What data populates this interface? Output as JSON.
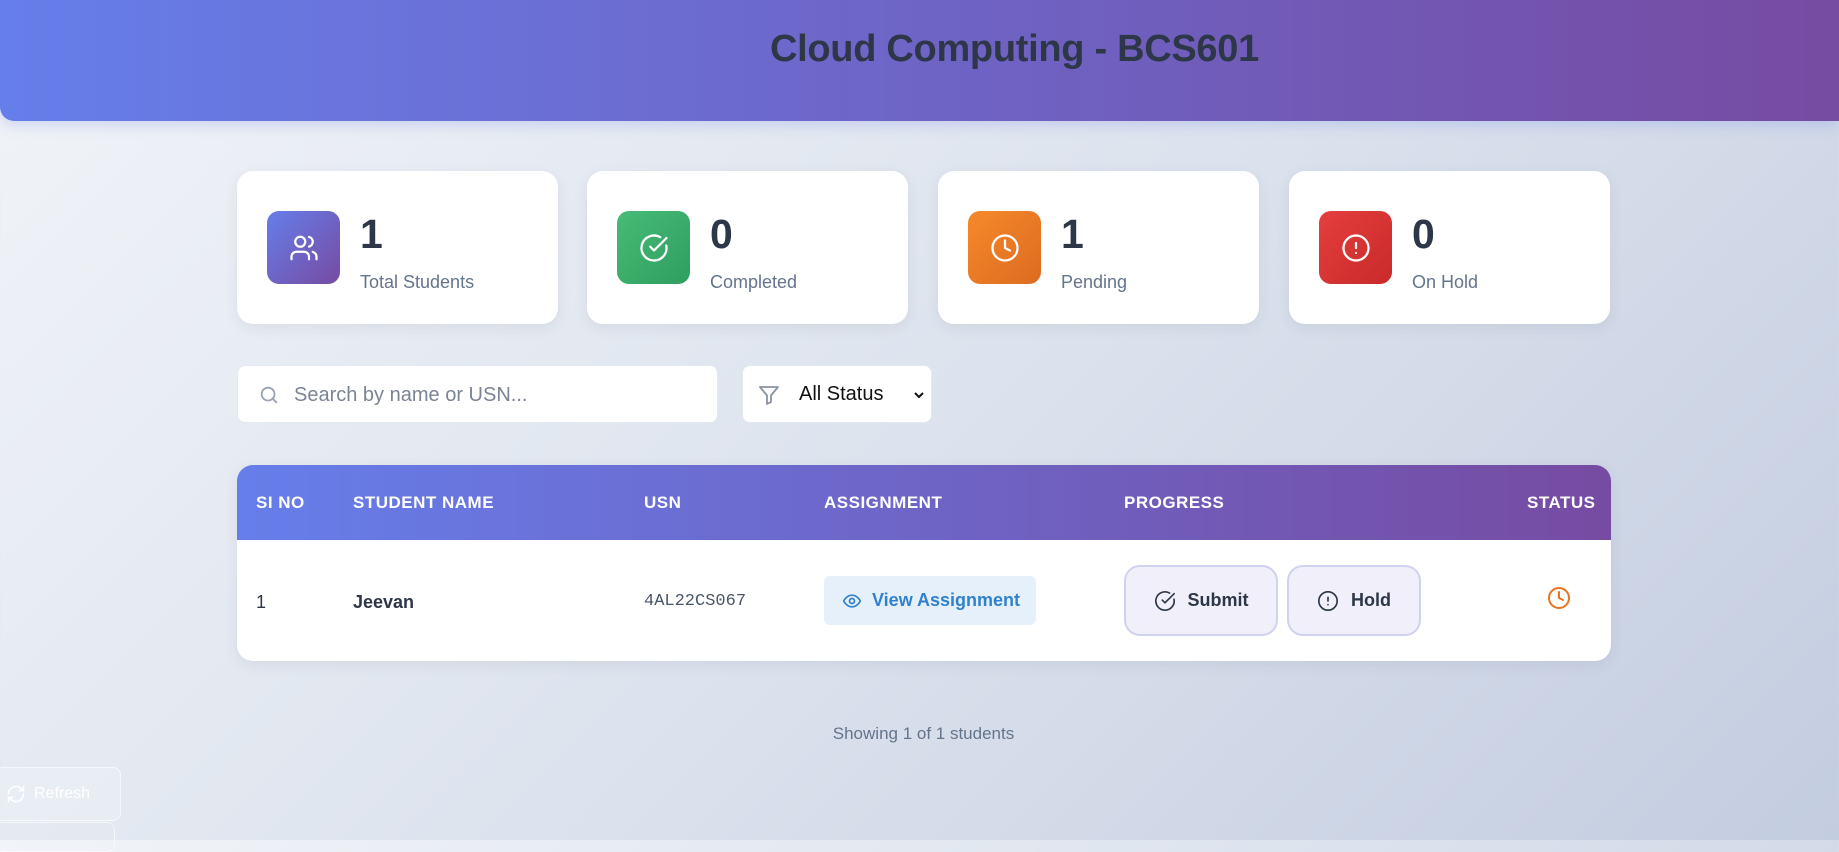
{
  "header": {
    "title": "Cloud Computing - BCS601"
  },
  "stats": [
    {
      "value": "1",
      "label": "Total Students",
      "icon": "users-icon",
      "color": "#6a5fd3"
    },
    {
      "value": "0",
      "label": "Completed",
      "icon": "check-circle-icon",
      "color": "#38a169"
    },
    {
      "value": "1",
      "label": "Pending",
      "icon": "clock-icon",
      "color": "#e9731f"
    },
    {
      "value": "0",
      "label": "On Hold",
      "icon": "alert-circle-icon",
      "color": "#dc2f2f"
    }
  ],
  "search": {
    "placeholder": "Search by name or USN...",
    "value": ""
  },
  "filter": {
    "selected": "All Status"
  },
  "table": {
    "headers": [
      "SI NO",
      "STUDENT NAME",
      "USN",
      "ASSIGNMENT",
      "PROGRESS",
      "STATUS"
    ],
    "rows": [
      {
        "si_no": "1",
        "name": "Jeevan",
        "usn": "4AL22CS067",
        "assignment_button": "View Assignment",
        "submit_button": "Submit",
        "hold_button": "Hold",
        "status_icon": "clock-icon"
      }
    ]
  },
  "footer": {
    "showing": "Showing 1 of 1 students"
  },
  "refresh": {
    "label": "Refresh"
  },
  "colors": {
    "gradient_start": "#667eea",
    "gradient_end": "#764ba2",
    "link_blue": "#3182ce",
    "pending_orange": "#e9731f"
  }
}
